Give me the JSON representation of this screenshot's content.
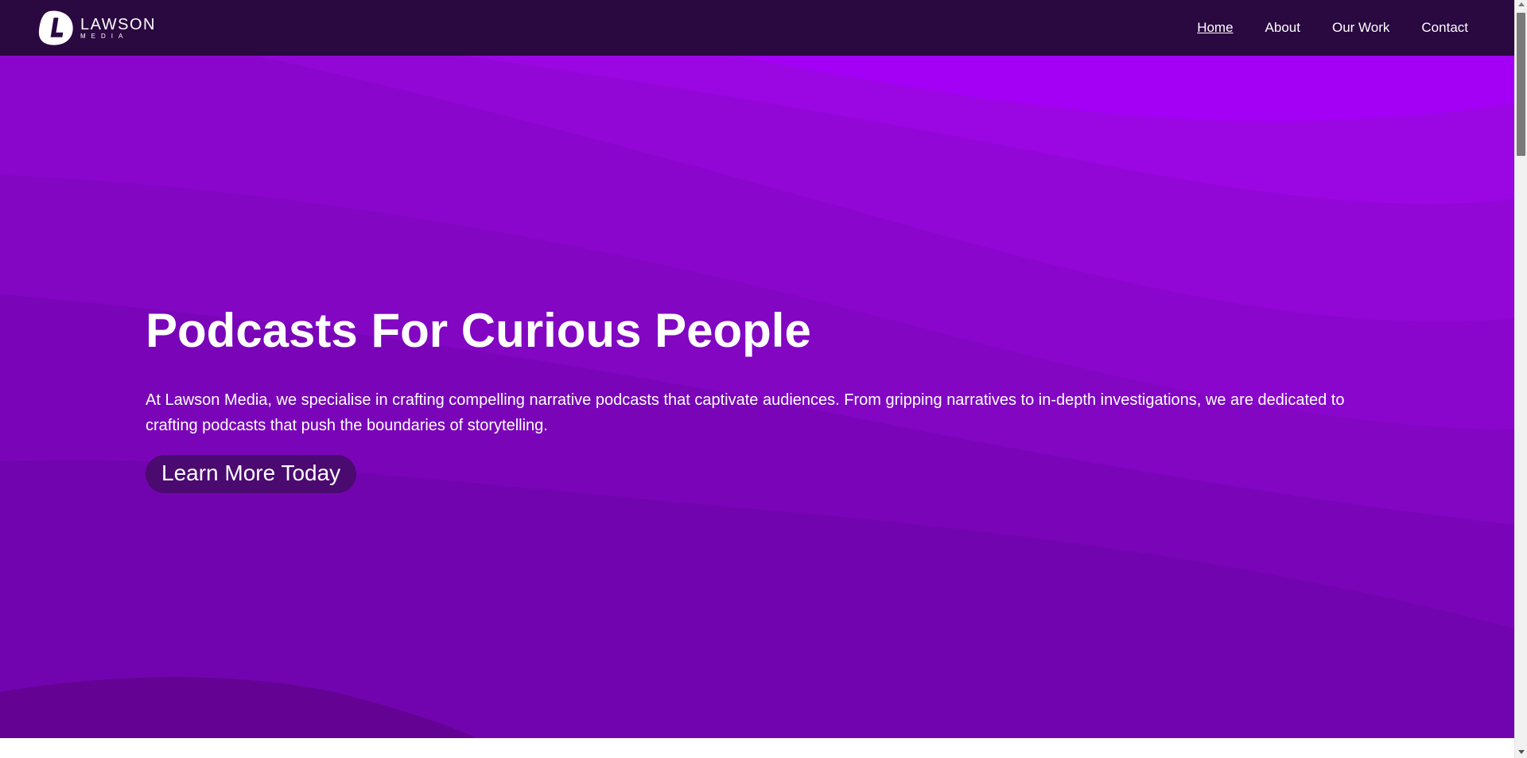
{
  "brand": {
    "name": "LAWSON",
    "subname": "MEDIA",
    "logo_icon": "lawson-l-logo-icon"
  },
  "nav": {
    "items": [
      {
        "label": "Home",
        "active": true
      },
      {
        "label": "About",
        "active": false
      },
      {
        "label": "Our Work",
        "active": false
      },
      {
        "label": "Contact",
        "active": false
      }
    ]
  },
  "hero": {
    "title": "Podcasts For Curious People",
    "description": "At Lawson Media, we specialise in crafting compelling narrative podcasts that captivate audiences. From gripping narratives to in-depth investigations, we are dedicated to crafting podcasts that push the boundaries of storytelling.",
    "cta_label": "Learn More Today"
  },
  "colors": {
    "navbar_bg": "#2a0840",
    "hero_bright": "#a000ff",
    "hero_dark": "#5a0090",
    "cta_bg": "#4a0a70",
    "text": "#ffffff"
  }
}
